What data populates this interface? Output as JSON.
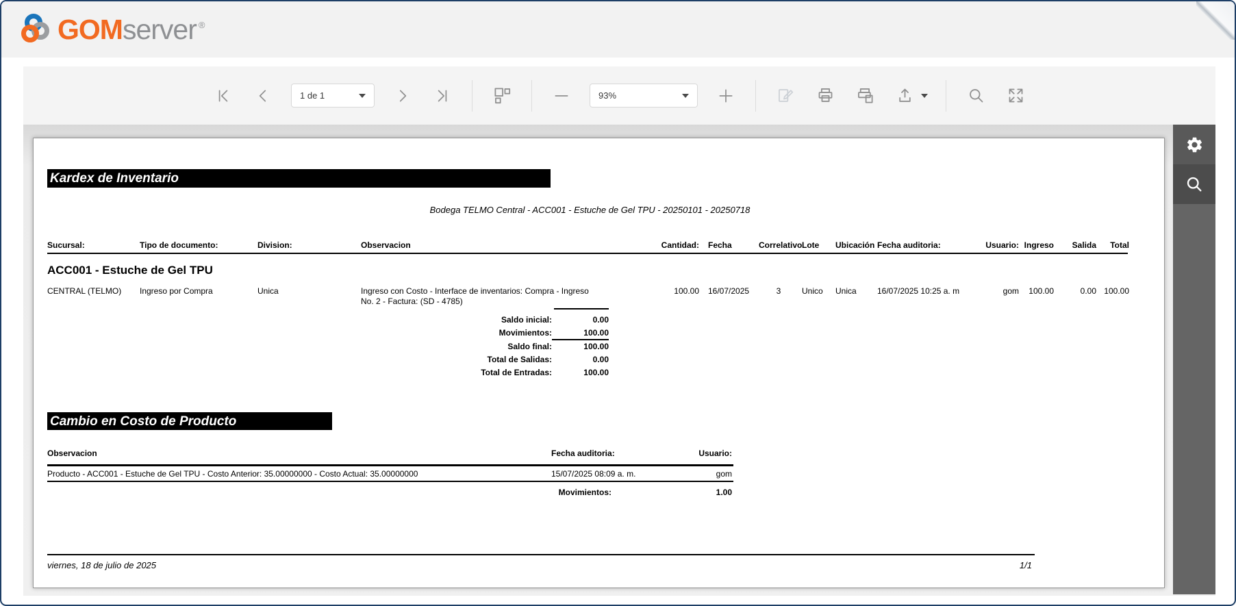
{
  "window": {
    "border_color": "#1d3e66"
  },
  "logo": {
    "brand_bold": "GOM",
    "brand_light": "server",
    "registered": "®",
    "orange": "#F26A21",
    "gray": "#8E9093",
    "blue": "#1B75BB"
  },
  "toolbar": {
    "page_select_value": "1 de 1",
    "zoom_select_value": "93%",
    "icons": [
      "first-page",
      "previous-page",
      "next-page",
      "last-page",
      "page-layout",
      "zoom-out",
      "zoom-in",
      "edit-parameters",
      "print",
      "print-page-setup",
      "export",
      "search",
      "fullscreen"
    ]
  },
  "side_menu": {
    "icons": [
      "settings-gear",
      "search-magnifier"
    ],
    "background": "#656565"
  },
  "report": {
    "section1_title": "Kardex de Inventario",
    "subtitle": "Bodega TELMO Central - ACC001 - Estuche de Gel TPU - 20250101 - 20250718",
    "kardex": {
      "headers": {
        "sucursal": "Sucursal:",
        "tipo": "Tipo de documento:",
        "division": "Division:",
        "observacion": "Observacion",
        "cantidad": "Cantidad:",
        "fecha": "Fecha",
        "correlativo": "Correlativo",
        "lote": "Lote",
        "ubicacion": "Ubicación",
        "fecha_auditoria": "Fecha auditoria:",
        "usuario": "Usuario:",
        "ingreso": "Ingreso",
        "salida": "Salida",
        "total": "Total"
      },
      "group_title": "ACC001 - Estuche de Gel TPU",
      "row": {
        "sucursal": "CENTRAL (TELMO)",
        "tipo": "Ingreso por Compra",
        "division": "Unica",
        "observacion": "Ingreso con Costo - Interface de inventarios: Compra - Ingreso No. 2 - Factura: (SD - 4785)",
        "cantidad": "100.00",
        "fecha": "16/07/2025",
        "correlativo": "3",
        "lote": "Unico",
        "ubicacion": "Unica",
        "fecha_auditoria": "16/07/2025 10:25 a. m",
        "usuario": "gom",
        "ingreso": "100.00",
        "salida": "0.00",
        "total": "100.00"
      },
      "summary": [
        {
          "label": "Saldo inicial:",
          "value": "0.00"
        },
        {
          "label": "Movimientos:",
          "value": "100.00"
        },
        {
          "label": "Saldo final:",
          "value": "100.00"
        },
        {
          "label": "Total de Salidas:",
          "value": "0.00"
        },
        {
          "label": "Total de Entradas:",
          "value": "100.00"
        }
      ]
    },
    "section2_title": "Cambio en Costo de Producto",
    "cost_change": {
      "headers": {
        "observacion": "Observacion",
        "fecha_auditoria": "Fecha auditoria:",
        "usuario": "Usuario:"
      },
      "row": {
        "observacion": "Producto - ACC001 - Estuche de Gel TPU - Costo Anterior: 35.00000000 - Costo Actual: 35.00000000",
        "fecha_auditoria": "15/07/2025 08:09 a. m.",
        "usuario": "gom"
      },
      "total_label": "Movimientos:",
      "total_value": "1.00"
    },
    "footer": {
      "date": "viernes, 18 de julio de 2025",
      "page_indicator": "1/1"
    }
  }
}
